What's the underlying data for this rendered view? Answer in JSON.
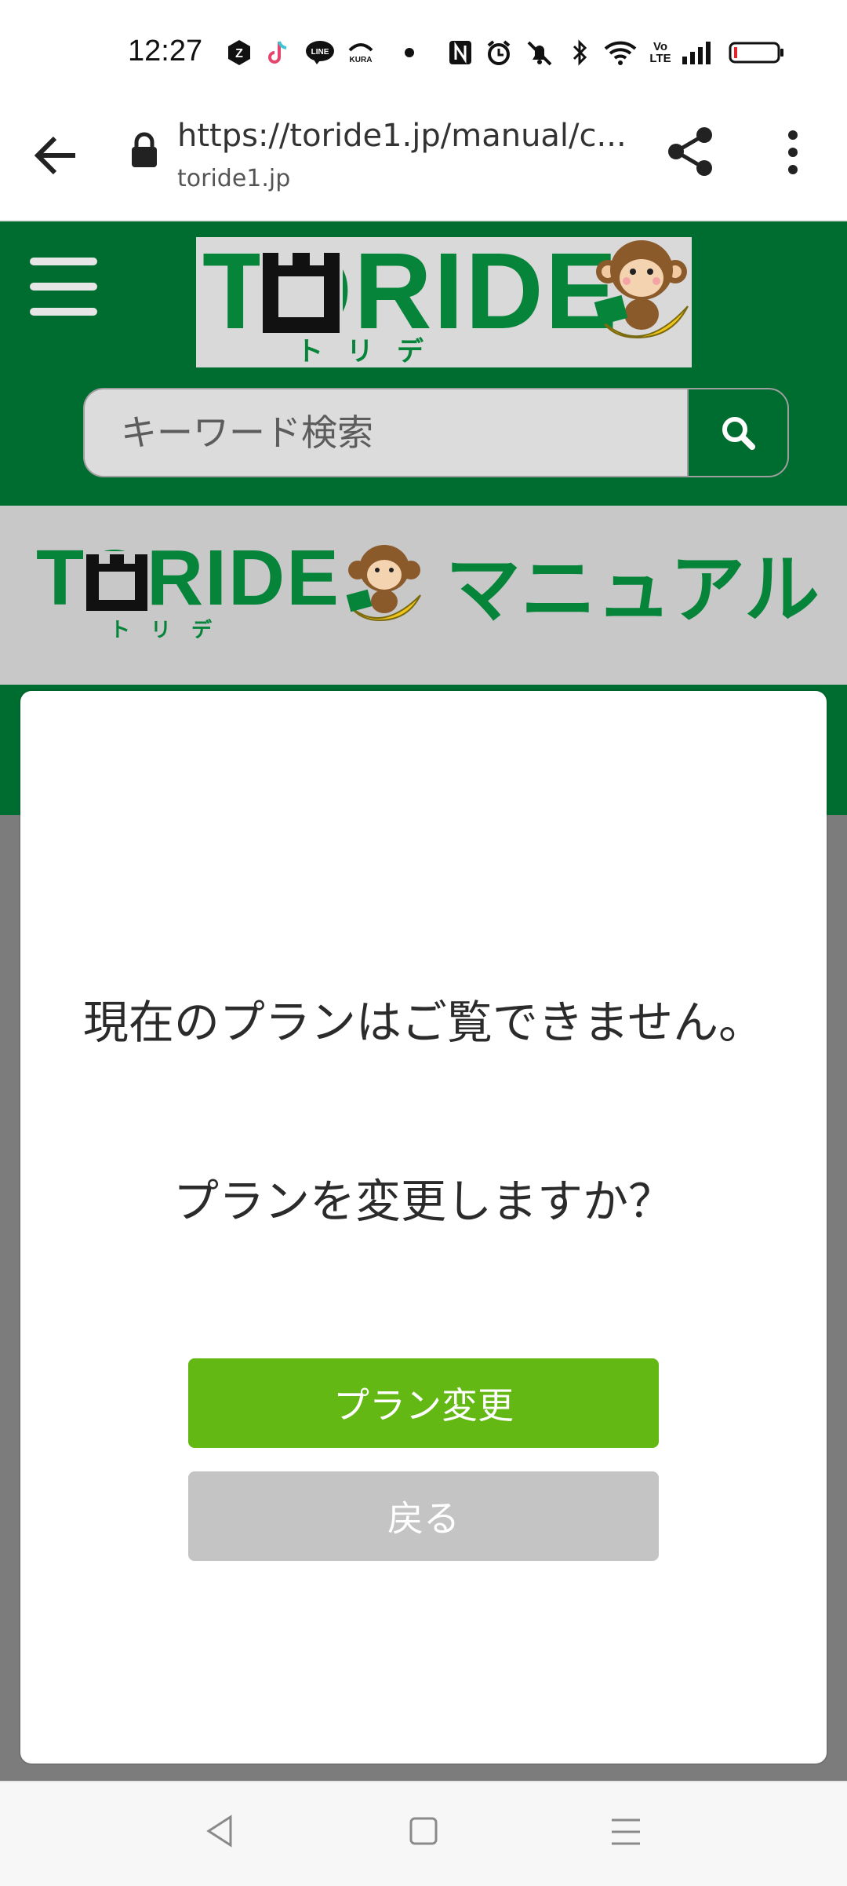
{
  "status_bar": {
    "time": "12:27",
    "icons": [
      "z-app-icon",
      "tiktok-icon",
      "line-icon",
      "kura-icon",
      "dot-icon",
      "nfc-icon",
      "alarm-icon",
      "mute-icon",
      "bluetooth-icon",
      "wifi-icon",
      "volte-icon",
      "signal-icon",
      "battery-icon"
    ],
    "line_label": "LINE",
    "kura_label": "KURA",
    "volte_label": "Vo LTE"
  },
  "browser": {
    "url": "https://toride1.jp/manual/c...",
    "domain": "toride1.jp"
  },
  "site_header": {
    "logo_text": "TORIDE",
    "logo_sub": "トリデ",
    "search_placeholder": "キーワード検索"
  },
  "banner": {
    "logo_text": "TORIDE",
    "logo_sub": "トリデ",
    "title": "マニュアル"
  },
  "dialog": {
    "message_line1": "現在のプランはご覧できません。",
    "message_line2": "プランを変更しますか？",
    "change_plan_label": "プラン変更",
    "back_label": "戻る"
  },
  "colors": {
    "header_green": "#006d30",
    "logo_green": "#06843a",
    "button_green": "#63b814",
    "button_gray": "#c4c4c4"
  }
}
